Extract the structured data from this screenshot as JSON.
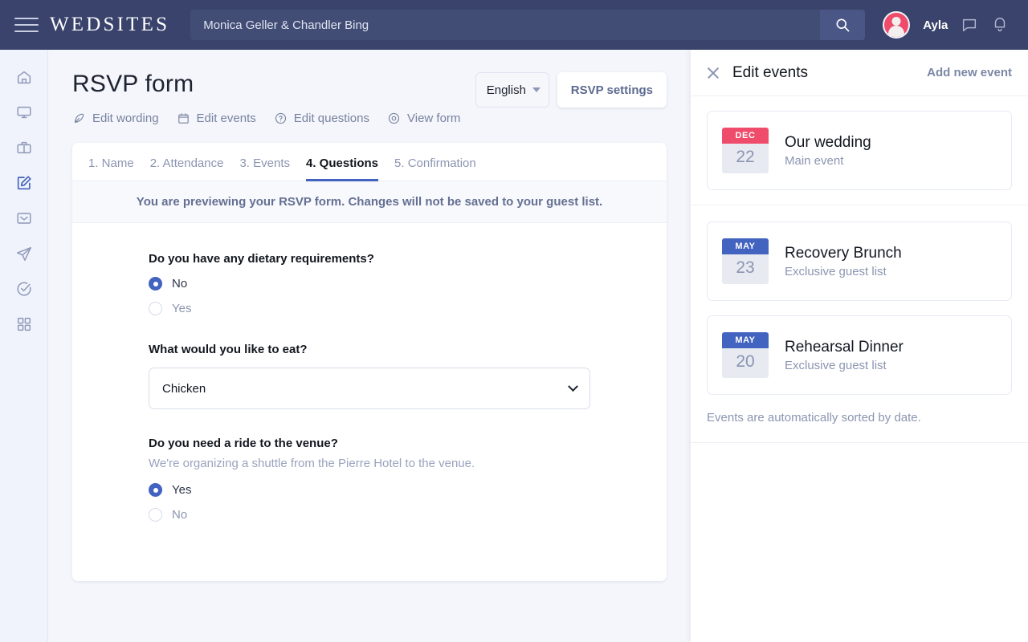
{
  "topbar": {
    "menu_icon": "hamburger-icon",
    "brand": "WEDSITES",
    "search_value": "Monica Geller & Chandler Bing",
    "search_placeholder": "Search",
    "search_icon": "search-icon",
    "username": "Ayla",
    "avatar_icon": "avatar",
    "chat_icon": "chat-bubble-icon",
    "bell_icon": "notification-bell-icon",
    "bg_color": "#39436b"
  },
  "sidebar": {
    "items": [
      {
        "name": "home",
        "icon": "home-icon",
        "active": false
      },
      {
        "name": "website",
        "icon": "monitor-icon",
        "active": false
      },
      {
        "name": "vendors",
        "icon": "briefcase-icon",
        "active": false
      },
      {
        "name": "rsvp",
        "icon": "edit-square-icon",
        "active": true
      },
      {
        "name": "mail",
        "icon": "envelope-icon",
        "active": false
      },
      {
        "name": "send",
        "icon": "paper-plane-icon",
        "active": false
      },
      {
        "name": "checklist",
        "icon": "check-circle-icon",
        "active": false
      },
      {
        "name": "apps",
        "icon": "grid-icon",
        "active": false
      }
    ],
    "active_color": "#4263bf"
  },
  "page": {
    "title": "RSVP form",
    "language": "English",
    "settings_button": "RSVP settings",
    "subnav": [
      {
        "label": "Edit wording",
        "icon": "feather-icon"
      },
      {
        "label": "Edit events",
        "icon": "calendar-icon"
      },
      {
        "label": "Edit questions",
        "icon": "question-circle-icon"
      },
      {
        "label": "View form",
        "icon": "eye-icon"
      }
    ],
    "tabs": [
      {
        "label": "1. Name",
        "active": false
      },
      {
        "label": "2. Attendance",
        "active": false
      },
      {
        "label": "3. Events",
        "active": false
      },
      {
        "label": "4. Questions",
        "active": true
      },
      {
        "label": "5. Confirmation",
        "active": false
      }
    ],
    "notice": "You are previewing your RSVP form. Changes will not be saved to your guest list."
  },
  "form": {
    "questions": [
      {
        "label": "Do you have any dietary requirements?",
        "help": "",
        "type": "radio",
        "options": [
          {
            "label": "No",
            "selected": true
          },
          {
            "label": "Yes",
            "selected": false
          }
        ]
      },
      {
        "label": "What would you like to eat?",
        "help": "",
        "type": "select",
        "value": "Chicken",
        "options": [
          "Chicken"
        ]
      },
      {
        "label": "Do you need a ride to the venue?",
        "help": "We're organizing a shuttle from the Pierre Hotel to the venue.",
        "type": "radio",
        "options": [
          {
            "label": "Yes",
            "selected": true
          },
          {
            "label": "No",
            "selected": false
          }
        ]
      }
    ]
  },
  "panel": {
    "close_icon": "close-icon",
    "title": "Edit events",
    "add_link": "Add new event",
    "events": [
      {
        "month": "DEC",
        "day": "22",
        "name": "Our wedding",
        "sub": "Main event",
        "month_color": "#ef4b6b"
      },
      {
        "month": "MAY",
        "day": "23",
        "name": "Recovery Brunch",
        "sub": "Exclusive guest list",
        "month_color": "#4263bf"
      },
      {
        "month": "MAY",
        "day": "20",
        "name": "Rehearsal Dinner",
        "sub": "Exclusive guest list",
        "month_color": "#4263bf"
      }
    ],
    "footer_note": "Events are automatically sorted by date."
  }
}
